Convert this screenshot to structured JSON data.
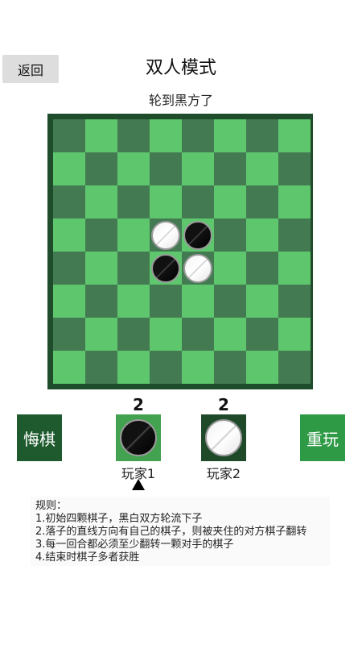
{
  "header": {
    "back_label": "返回",
    "title": "双人模式",
    "turn_text": "轮到黑方了"
  },
  "board": {
    "size": 8,
    "pieces": [
      {
        "row": 3,
        "col": 3,
        "color": "white"
      },
      {
        "row": 3,
        "col": 4,
        "color": "black"
      },
      {
        "row": 4,
        "col": 3,
        "color": "black"
      },
      {
        "row": 4,
        "col": 4,
        "color": "white"
      }
    ],
    "colors": {
      "dark": "#447a52",
      "light": "#5ec76e",
      "frame": "#1f4d2c"
    }
  },
  "controls": {
    "undo_label": "悔棋",
    "restart_label": "重玩"
  },
  "players": [
    {
      "score": "2",
      "name": "玩家1",
      "piece": "black",
      "active": true
    },
    {
      "score": "2",
      "name": "玩家2",
      "piece": "white",
      "active": false
    }
  ],
  "rules": {
    "heading": "规则：",
    "items": [
      "1.初始四颗棋子，黑白双方轮流下子",
      "2.落子的直线方向有自己的棋子，则被夹住的对方棋子翻转",
      "3.每一回合都必须至少翻转一颗对手的棋子",
      "4.结束时棋子多者获胜"
    ]
  }
}
